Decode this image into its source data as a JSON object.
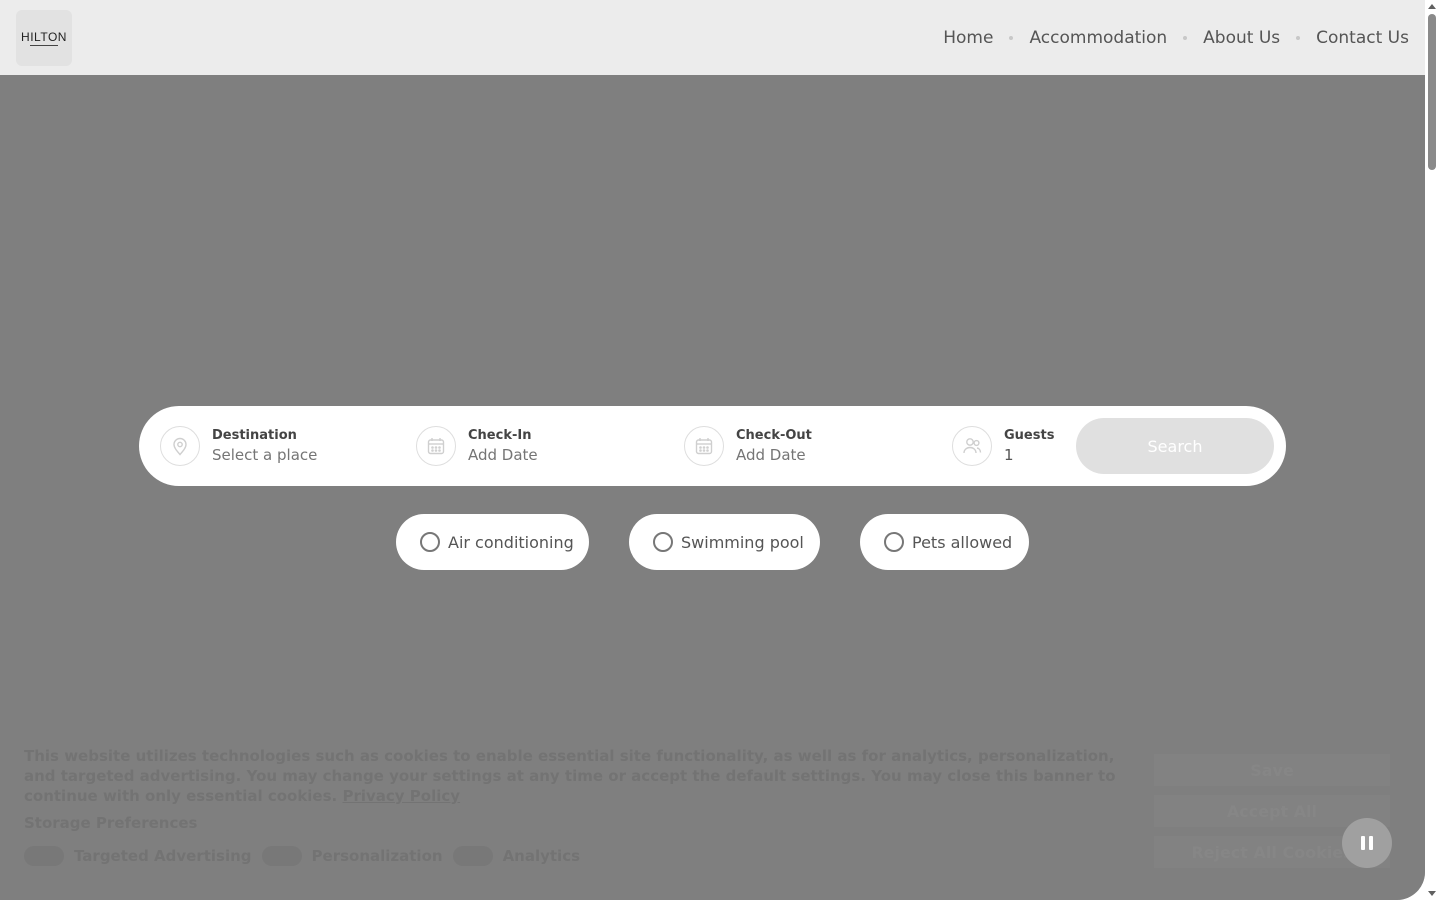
{
  "header": {
    "logo_text": "HILTON",
    "nav": [
      {
        "label": "Home"
      },
      {
        "label": "Accommodation"
      },
      {
        "label": "About Us"
      },
      {
        "label": "Contact Us"
      }
    ]
  },
  "search": {
    "destination": {
      "label": "Destination",
      "placeholder": "Select a place",
      "icon": "map-pin-icon"
    },
    "check_in": {
      "label": "Check-In",
      "placeholder": "Add Date",
      "icon": "calendar-icon"
    },
    "check_out": {
      "label": "Check-Out",
      "placeholder": "Add Date",
      "icon": "calendar-icon"
    },
    "guests": {
      "label": "Guests",
      "value": "1",
      "icon": "users-icon"
    },
    "button_label": "Search"
  },
  "amenities": [
    {
      "label": "Air conditioning",
      "checked": false
    },
    {
      "label": "Swimming pool",
      "checked": false
    },
    {
      "label": "Pets allowed",
      "checked": false
    }
  ],
  "cookie_banner": {
    "text": "This website utilizes technologies such as cookies to enable essential site functionality, as well as for analytics, personalization, and targeted advertising. You may change your settings at any time or accept the default settings. You may close this banner to continue with only essential cookies.",
    "privacy_link": "Privacy Policy",
    "preferences_title": "Storage Preferences",
    "toggles": [
      {
        "label": "Targeted Advertising"
      },
      {
        "label": "Personalization"
      },
      {
        "label": "Analytics"
      }
    ],
    "buttons": [
      {
        "label": "Save"
      },
      {
        "label": "Accept All"
      },
      {
        "label": "Reject All Cookies"
      }
    ]
  },
  "media_control": {
    "icon": "pause-icon"
  },
  "colors": {
    "overlay": "#7f7f7f",
    "header_bg": "#ececec",
    "search_button": "#e0e0e0"
  }
}
